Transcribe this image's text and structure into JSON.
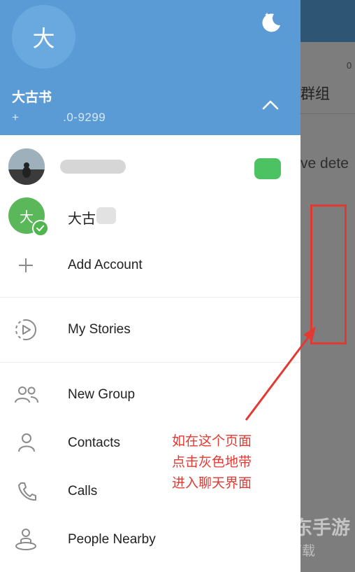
{
  "drawer": {
    "avatar_letter": "大",
    "user_name": "大古书",
    "phone": "+            .0-9299",
    "accounts": [
      {
        "name": "",
        "has_photo": true
      },
      {
        "avatar_letter": "大",
        "name_visible": "大古"
      }
    ],
    "add_account": "Add Account",
    "my_stories": "My Stories",
    "menu": [
      {
        "label": "New Group",
        "icon": "group-icon"
      },
      {
        "label": "Contacts",
        "icon": "person-icon"
      },
      {
        "label": "Calls",
        "icon": "phone-icon"
      },
      {
        "label": "People Nearby",
        "icon": "location-person-icon"
      }
    ]
  },
  "background_chat": {
    "time": "0",
    "title_fragment": "群组",
    "text_fragment": "ve dete",
    "watermark_line1": "爱东东手游",
    "watermark_line2": "听一听下载"
  },
  "annotation": {
    "line1": "如在这个页面",
    "line2": "点击灰色地带",
    "line3": "进入聊天界面"
  },
  "colors": {
    "header": "#5b9bd5",
    "annotation": "#e23a32",
    "accent_green": "#4cc262"
  }
}
